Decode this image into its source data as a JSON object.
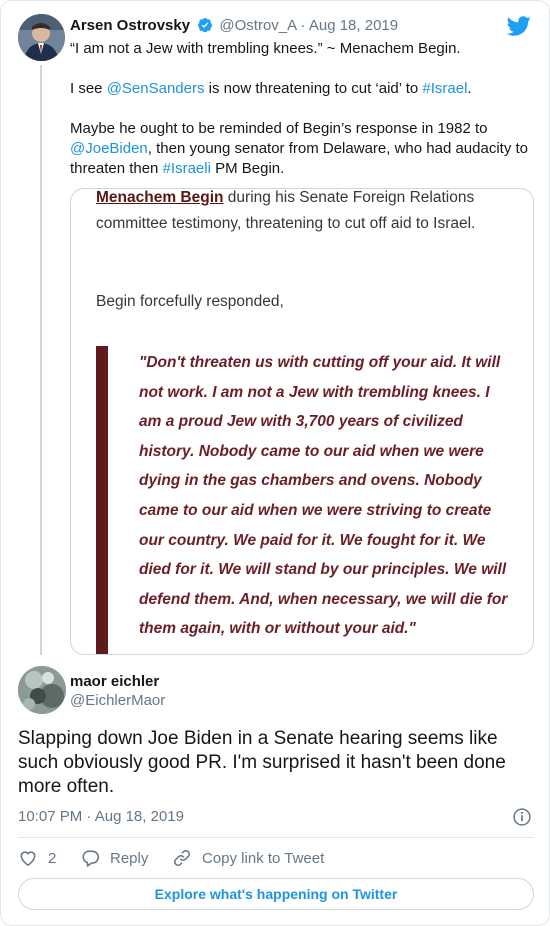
{
  "quoted_tweet": {
    "author_name": "Arsen Ostrovsky",
    "handle": "@Ostrov_A",
    "separator": "·",
    "date": "Aug 18, 2019",
    "paragraphs": [
      [
        {
          "text": "“I am not a Jew with trembling knees.” ~ Menachem Begin.",
          "link": false
        }
      ],
      [
        {
          "text": "I see ",
          "link": false
        },
        {
          "text": "@SenSanders",
          "link": true
        },
        {
          "text": " is now threatening to cut ‘aid’ to ",
          "link": false
        },
        {
          "text": "#Israel",
          "link": true
        },
        {
          "text": ".",
          "link": false
        }
      ],
      [
        {
          "text": "Maybe he ought to be reminded of Begin’s response in 1982 to ",
          "link": false
        },
        {
          "text": "@JoeBiden",
          "link": true
        },
        {
          "text": ", then young senator from Delaware, who had audacity to threaten then ",
          "link": false
        },
        {
          "text": "#Israeli",
          "link": true
        },
        {
          "text": " PM Begin.",
          "link": false
        }
      ]
    ],
    "image": {
      "top_name": "Menachem Begin",
      "top_text": " during his Senate Foreign Relations committee testimony, threatening to cut off aid to Israel.",
      "begin_line": "Begin forcefully responded,",
      "quote": "\"Don't threaten us with cutting off your aid. It will not work. I am not a Jew with trembling knees. I am a proud Jew with 3,700 years of civilized history. Nobody came to our aid when we were dying in the gas chambers and ovens. Nobody came to our aid when we were striving to create our country. We paid for it. We fought for it. We died for it. We will stand by our principles. We will defend them. And, when necessary, we will die for them again, with or without your aid.\""
    }
  },
  "tweet": {
    "author_name": "maor eichler",
    "handle": "@EichlerMaor",
    "text": "Slapping down Joe Biden in a Senate hearing seems like such obviously good PR. I'm surprised it hasn't been done more often.",
    "time": "10:07 PM",
    "separator": "·",
    "date": "Aug 18, 2019"
  },
  "actions": {
    "like_count": "2",
    "reply_label": "Reply",
    "copy_link_label": "Copy link to Tweet"
  },
  "explore_label": "Explore what's happening on Twitter",
  "icons": {
    "verified": "verified-badge-icon",
    "twitter": "twitter-bird-icon",
    "info": "info-icon",
    "like": "heart-icon",
    "reply": "reply-bubble-icon",
    "link": "link-icon"
  },
  "colors": {
    "link": "#1b95e0",
    "secondary_text": "#657786",
    "quote_text": "#6b1f25",
    "quote_bar": "#5f1a1d"
  }
}
